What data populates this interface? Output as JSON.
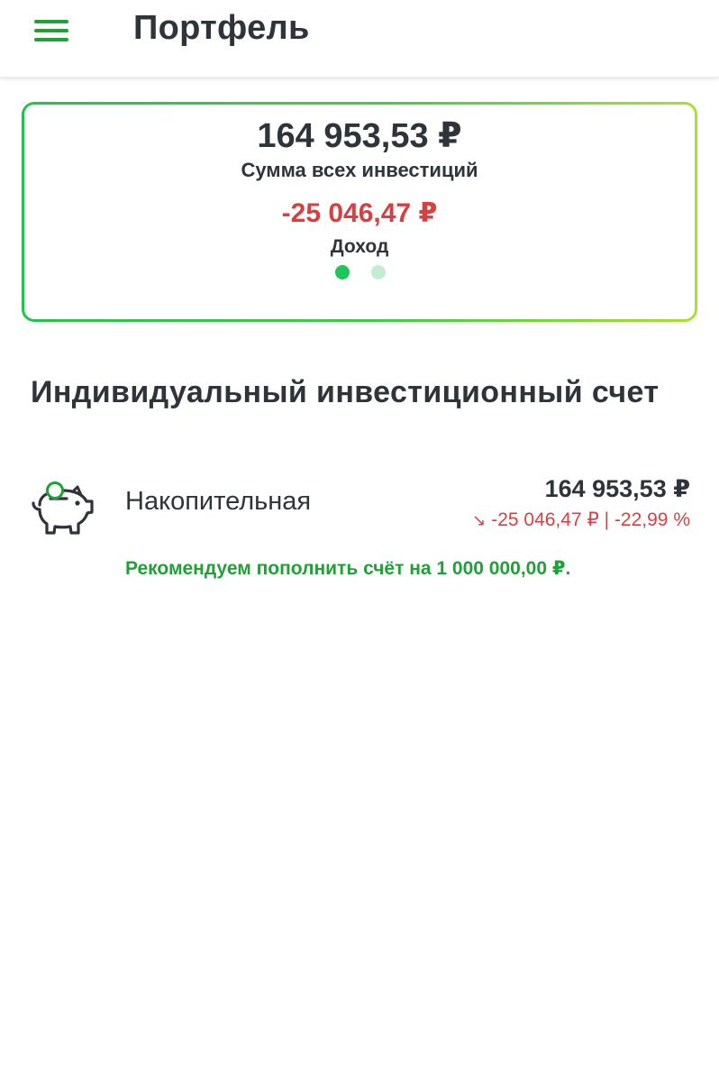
{
  "header": {
    "title": "Портфель",
    "menu_icon": "hamburger-menu-icon"
  },
  "summary": {
    "total_value": "164 953,53 ₽",
    "total_label": "Сумма всех инвестиций",
    "income_value": "-25 046,47 ₽",
    "income_label": "Доход",
    "pages": 2,
    "active_page": 1
  },
  "section": {
    "title": "Индивидуальный инвестиционный счет"
  },
  "account": {
    "icon": "piggy-bank-icon",
    "name": "Накопительная",
    "amount": "164 953,53 ₽",
    "change_arrow": "↘",
    "change": "-25 046,47 ₽ | -22,99 %",
    "recommendation": "Рекомендуем пополнить счёт на 1 000 000,00 ₽."
  },
  "colors": {
    "accent_green": "#21a038",
    "negative_red": "#d93f3f",
    "text_dark": "#2e343a",
    "dot_active": "#21c45a",
    "dot_inactive": "#c5ecd3"
  }
}
